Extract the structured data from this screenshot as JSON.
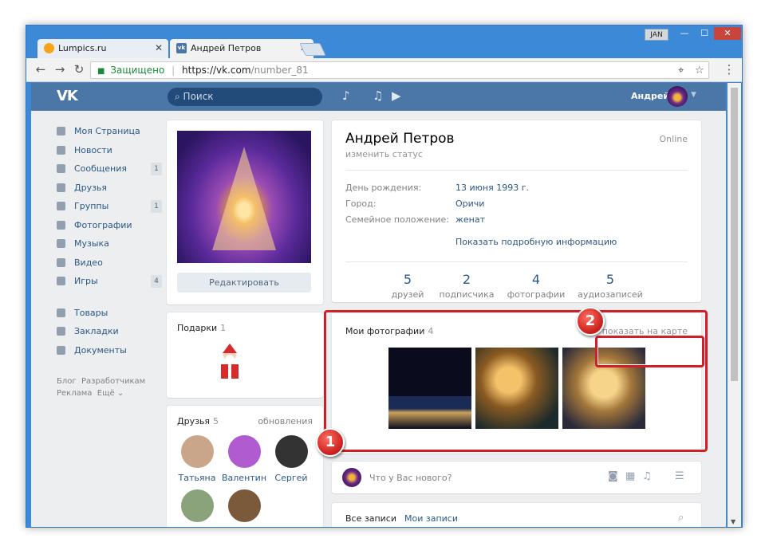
{
  "browser": {
    "tabs": [
      {
        "title": "Lumpics.ru",
        "close": "✕"
      },
      {
        "title": "Андрей Петров",
        "close": "✕"
      }
    ],
    "lang": "JAN",
    "address": {
      "secure_label": "Защищено",
      "host": "https://vk.com",
      "path": "/number_81"
    }
  },
  "vk": {
    "logo": "VK",
    "search_placeholder": "Поиск",
    "user_name": "Андрей",
    "menu": [
      {
        "label": "Моя Страница",
        "badge": ""
      },
      {
        "label": "Новости",
        "badge": ""
      },
      {
        "label": "Сообщения",
        "badge": "1"
      },
      {
        "label": "Друзья",
        "badge": ""
      },
      {
        "label": "Группы",
        "badge": "1"
      },
      {
        "label": "Фотографии",
        "badge": ""
      },
      {
        "label": "Музыка",
        "badge": ""
      },
      {
        "label": "Видео",
        "badge": ""
      },
      {
        "label": "Игры",
        "badge": "4"
      }
    ],
    "menu2": [
      {
        "label": "Товары"
      },
      {
        "label": "Закладки"
      },
      {
        "label": "Документы"
      }
    ],
    "footer_links": [
      "Блог",
      "Разработчикам",
      "Реклама",
      "Ещё ⌄"
    ]
  },
  "profile": {
    "edit_button": "Редактировать",
    "gifts_title": "Подарки",
    "gifts_count": "1",
    "friends_title": "Друзья",
    "friends_count": "5",
    "friends_updates": "обновления",
    "friends": [
      {
        "name": "Татьяна",
        "color": "#c9a58a"
      },
      {
        "name": "Валентин",
        "color": "#b05cd0"
      },
      {
        "name": "Сергей",
        "color": "#333333"
      },
      {
        "name": "",
        "color": "#8aa37a"
      },
      {
        "name": "",
        "color": "#7a5a3a"
      }
    ],
    "name": "Андрей Петров",
    "status": "изменить статус",
    "online": "Online",
    "info": [
      {
        "label": "День рождения:",
        "value": "13 июня 1993 г."
      },
      {
        "label": "Город:",
        "value": "Оричи"
      },
      {
        "label": "Семейное положение:",
        "value": "женат"
      }
    ],
    "more_info": "Показать подробную информацию",
    "stats": [
      {
        "num": "5",
        "label": "друзей"
      },
      {
        "num": "2",
        "label": "подписчика"
      },
      {
        "num": "4",
        "label": "фотографии"
      },
      {
        "num": "5",
        "label": "аудиозаписей"
      }
    ],
    "photos_title": "Мои фотографии",
    "photos_count": "4",
    "show_on_map": "показать на карте",
    "new_post_placeholder": "Что у Вас нового?",
    "wall_tabs": [
      "Все записи",
      "Мои записи"
    ]
  },
  "annotations": {
    "marker1": "1",
    "marker2": "2",
    "highlight_color": "#d11f27"
  }
}
